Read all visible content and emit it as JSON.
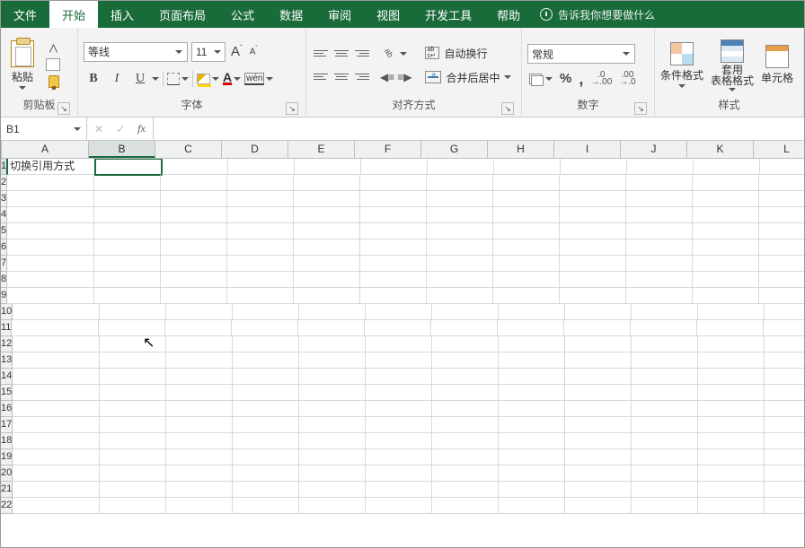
{
  "menu": {
    "tabs": [
      "文件",
      "开始",
      "插入",
      "页面布局",
      "公式",
      "数据",
      "审阅",
      "视图",
      "开发工具",
      "帮助"
    ],
    "active": 1,
    "tellme": "告诉我你想要做什么"
  },
  "ribbon": {
    "clipboard": {
      "paste": "粘贴",
      "label": "剪贴板"
    },
    "font": {
      "label": "字体",
      "name": "等线",
      "size": "11",
      "bold": "B",
      "ital": "I",
      "ul": "U",
      "a": "A",
      "wen": "wén"
    },
    "align": {
      "label": "对齐方式",
      "wrap": "自动换行",
      "merge": "合并后居中"
    },
    "number": {
      "label": "数字",
      "format": "常规",
      "pct": "%",
      "comma": ",",
      "decinc": ".0\n.00",
      "decdec": ".00\n.0"
    },
    "styles": {
      "label": "样式",
      "cond": "条件格式",
      "table": "套用\n表格格式",
      "cell": "单元格"
    }
  },
  "formula": {
    "namebox": "B1",
    "fx": "fx"
  },
  "grid": {
    "cols": [
      "A",
      "B",
      "C",
      "D",
      "E",
      "F",
      "G",
      "H",
      "I",
      "J",
      "K",
      "L"
    ],
    "wideCol": 0,
    "selCol": 1,
    "selRow": 0,
    "rows": 22,
    "cells": {
      "0-0": "切换引用方式"
    }
  }
}
